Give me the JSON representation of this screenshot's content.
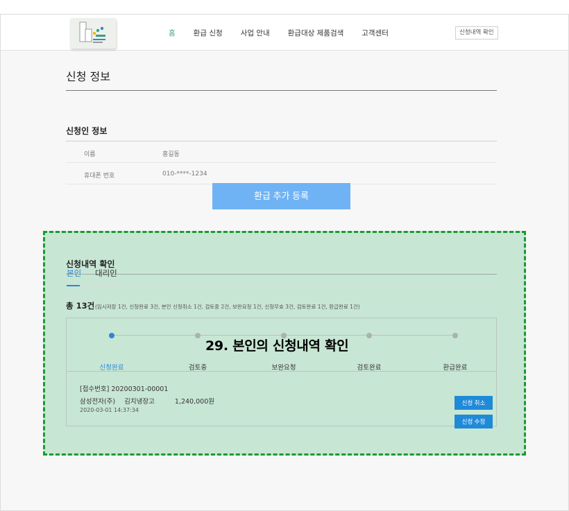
{
  "header": {
    "nav": [
      "홈",
      "환급 신청",
      "사업 안내",
      "환급대상 제품검색",
      "고객센터"
    ],
    "active_nav": 0,
    "check_button": "신청내역 확인"
  },
  "page": {
    "title": "신청 정보"
  },
  "applicant": {
    "section_title": "신청인 정보",
    "rows": [
      {
        "label": "이름",
        "value": "홍길동"
      },
      {
        "label": "휴대폰 번호",
        "value": "010-****-1234"
      }
    ],
    "add_button": "환급 추가 등록"
  },
  "history": {
    "section_title": "신청내역 확인",
    "tabs": [
      "본인",
      "대리인"
    ],
    "total": "총 13건",
    "total_detail": "(임시저장 1건, 신청완료 3건, 본인 신청취소 1건, 검토중 2건, 보완요청 1건, 신청무효 3건, 검토완료 1건, 환급완료 1건)",
    "steps": [
      "신청완료",
      "검토중",
      "보완요청",
      "검토완료",
      "환급완료"
    ],
    "active_step": 0,
    "record": {
      "receipt_no": "[접수번호] 20200301-00001",
      "company": "삼성전자(주)",
      "product": "김치냉장고",
      "amount": "1,240,000원",
      "datetime": "2020-03-01 14:37:34",
      "cancel_button": "신청 취소",
      "edit_button": "신청 수정"
    }
  },
  "overlay_label": "29. 본인의 신청내역 확인",
  "colors": {
    "accent_blue": "#2b87d8",
    "highlight_bg": "#c8e6d4",
    "highlight_border": "#1a9a32",
    "nav_active": "#3aa272"
  }
}
